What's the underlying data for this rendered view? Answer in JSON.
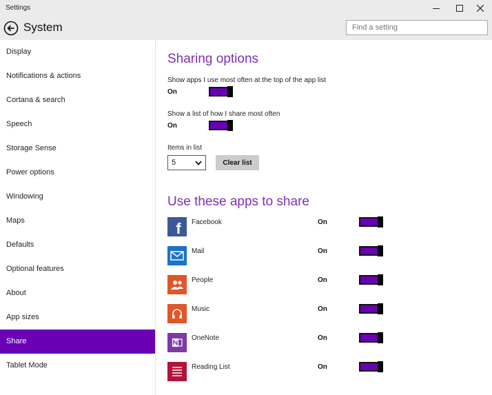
{
  "window": {
    "title": "Settings"
  },
  "header": {
    "title": "System",
    "search_placeholder": "Find a setting"
  },
  "sidebar": {
    "items": [
      {
        "label": "Display"
      },
      {
        "label": "Notifications & actions"
      },
      {
        "label": "Cortana & search"
      },
      {
        "label": "Speech"
      },
      {
        "label": "Storage Sense"
      },
      {
        "label": "Power options"
      },
      {
        "label": "Windowing"
      },
      {
        "label": "Maps"
      },
      {
        "label": "Defaults"
      },
      {
        "label": "Optional features"
      },
      {
        "label": "About"
      },
      {
        "label": "App sizes"
      },
      {
        "label": "Share",
        "active": true
      },
      {
        "label": "Tablet Mode"
      }
    ]
  },
  "sharing": {
    "heading": "Sharing options",
    "option1": {
      "label": "Show apps I use most often at the top of the app list",
      "state": "On"
    },
    "option2": {
      "label": "Show a list of how I share most often",
      "state": "On"
    },
    "items_label": "Items in list",
    "items_value": "5",
    "clear_label": "Clear list"
  },
  "apps": {
    "heading": "Use these apps to share",
    "list": [
      {
        "name": "Facebook",
        "state": "On",
        "icon": "facebook-icon",
        "color": "#3b5998"
      },
      {
        "name": "Mail",
        "state": "On",
        "icon": "mail-icon",
        "color": "#1a73c9"
      },
      {
        "name": "People",
        "state": "On",
        "icon": "people-icon",
        "color": "#e0562a"
      },
      {
        "name": "Music",
        "state": "On",
        "icon": "music-icon",
        "color": "#e0562a"
      },
      {
        "name": "OneNote",
        "state": "On",
        "icon": "onenote-icon",
        "color": "#7d3aa6"
      },
      {
        "name": "Reading List",
        "state": "On",
        "icon": "reading-list-icon",
        "color": "#b3133b"
      }
    ]
  },
  "colors": {
    "accent": "#6a00b4",
    "heading": "#7e2fb5"
  }
}
